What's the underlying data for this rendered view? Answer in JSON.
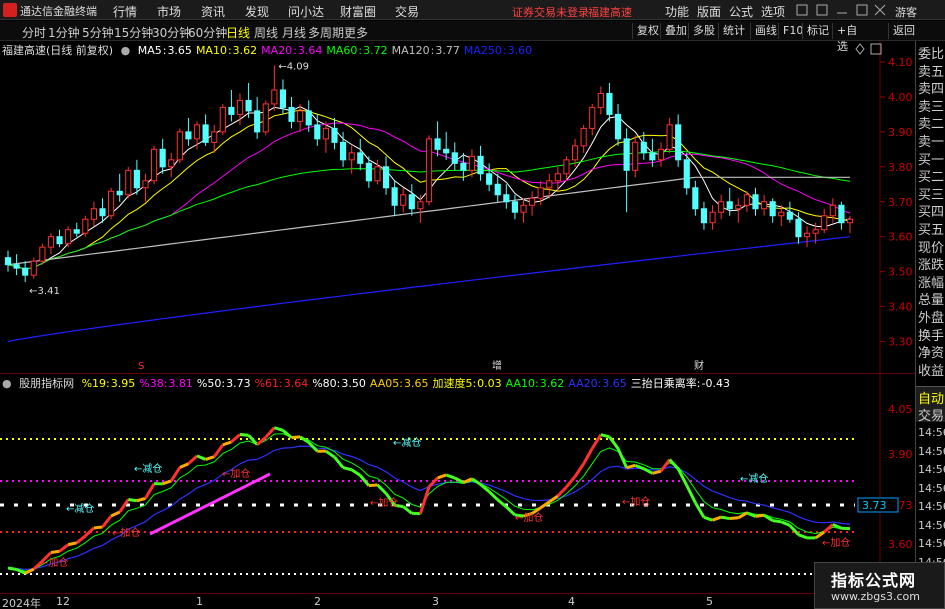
{
  "app": {
    "title": "通达信金融终端",
    "menu": [
      "行情",
      "市场",
      "资讯",
      "发现",
      "问小达",
      "财富圈",
      "交易"
    ],
    "account_status": "证券交易未登录",
    "account_stock": "福建高速",
    "right_menu": [
      "功能",
      "版面",
      "公式",
      "选项"
    ],
    "guest": "游客"
  },
  "periods": [
    "分时",
    "1分钟",
    "5分钟",
    "15分钟",
    "30分钟",
    "60分钟",
    "日线",
    "周线",
    "月线",
    "多周期",
    "更多"
  ],
  "active_period": "日线",
  "tools": [
    "复权",
    "叠加",
    "多股",
    "统计",
    "画线",
    "F10",
    "标记",
    "+自选",
    "返回"
  ],
  "main_chart": {
    "stock_label": "福建高速(日线 前复权)",
    "ma": [
      {
        "name": "MA5",
        "value": "3.65",
        "color": "#ffffff"
      },
      {
        "name": "MA10",
        "value": "3.62",
        "color": "#ffff00"
      },
      {
        "name": "MA20",
        "value": "3.64",
        "color": "#ff00ff"
      },
      {
        "name": "MA60",
        "value": "3.72",
        "color": "#00ff00"
      },
      {
        "name": "MA120",
        "value": "3.77",
        "color": "#c0c0c0"
      },
      {
        "name": "MA250",
        "value": "3.60",
        "color": "#2020ff"
      }
    ],
    "high_marker": "4.09",
    "low_marker": "3.41",
    "event_markers": [
      "S",
      "增",
      "财"
    ]
  },
  "indicator": {
    "name": "股朋指标网",
    "values": [
      {
        "label": "%19:",
        "value": "3.95",
        "color": "#ffff00"
      },
      {
        "label": "%38:",
        "value": "3.81",
        "color": "#ff00ff"
      },
      {
        "label": "%50:",
        "value": "3.73",
        "color": "#ffffff"
      },
      {
        "label": "%61:",
        "value": "3.64",
        "color": "#ff2020"
      },
      {
        "label": "%80:",
        "value": "3.50",
        "color": "#ffffff"
      },
      {
        "label": "AA05:",
        "value": "3.65",
        "color": "#ffcc00"
      },
      {
        "label": "加速度5:",
        "value": "0.03",
        "color": "#ffff00"
      },
      {
        "label": "AA10:",
        "value": "3.62",
        "color": "#00ff00"
      },
      {
        "label": "AA20:",
        "value": "3.65",
        "color": "#3030ff"
      },
      {
        "label": "三抬日乘离率:",
        "value": "-0.43",
        "color": "#ffffff"
      }
    ],
    "labels_reduce": "←减仓",
    "labels_add": "←加仓",
    "current_tag": "3.73"
  },
  "chart_data": {
    "type": "candlestick",
    "title": "福建高速(日线 前复权)",
    "y_axis_main": [
      "4.10",
      "4.00",
      "3.90",
      "3.80",
      "3.70",
      "3.60",
      "3.50",
      "3.40",
      "3.30"
    ],
    "ylim_main": [
      3.25,
      4.12
    ],
    "y_axis_ind": [
      "4.05",
      "3.90",
      "3.73",
      "3.60"
    ],
    "x_labels": [
      "2024年",
      "12",
      "1",
      "2",
      "3",
      "4",
      "5"
    ],
    "ohlc": [
      [
        3.54,
        3.56,
        3.5,
        3.52
      ],
      [
        3.52,
        3.55,
        3.49,
        3.51
      ],
      [
        3.51,
        3.53,
        3.47,
        3.49
      ],
      [
        3.49,
        3.54,
        3.48,
        3.53
      ],
      [
        3.53,
        3.58,
        3.52,
        3.57
      ],
      [
        3.57,
        3.61,
        3.55,
        3.6
      ],
      [
        3.6,
        3.62,
        3.57,
        3.58
      ],
      [
        3.58,
        3.63,
        3.57,
        3.62
      ],
      [
        3.62,
        3.64,
        3.6,
        3.61
      ],
      [
        3.61,
        3.66,
        3.6,
        3.65
      ],
      [
        3.65,
        3.7,
        3.63,
        3.68
      ],
      [
        3.68,
        3.71,
        3.64,
        3.66
      ],
      [
        3.66,
        3.74,
        3.65,
        3.73
      ],
      [
        3.73,
        3.78,
        3.7,
        3.72
      ],
      [
        3.72,
        3.8,
        3.71,
        3.79
      ],
      [
        3.79,
        3.82,
        3.72,
        3.74
      ],
      [
        3.74,
        3.78,
        3.7,
        3.76
      ],
      [
        3.76,
        3.86,
        3.75,
        3.85
      ],
      [
        3.85,
        3.88,
        3.78,
        3.8
      ],
      [
        3.8,
        3.84,
        3.77,
        3.82
      ],
      [
        3.82,
        3.91,
        3.81,
        3.9
      ],
      [
        3.9,
        3.94,
        3.86,
        3.88
      ],
      [
        3.88,
        3.93,
        3.85,
        3.92
      ],
      [
        3.92,
        3.95,
        3.86,
        3.87
      ],
      [
        3.87,
        3.92,
        3.84,
        3.9
      ],
      [
        3.9,
        3.98,
        3.89,
        3.97
      ],
      [
        3.97,
        4.02,
        3.93,
        3.95
      ],
      [
        3.95,
        4.01,
        3.92,
        3.99
      ],
      [
        3.99,
        4.04,
        3.94,
        3.96
      ],
      [
        3.96,
        4.0,
        3.88,
        3.9
      ],
      [
        3.9,
        3.99,
        3.89,
        3.98
      ],
      [
        3.98,
        4.09,
        3.96,
        4.02
      ],
      [
        4.02,
        4.05,
        3.95,
        3.97
      ],
      [
        3.97,
        4.0,
        3.91,
        3.93
      ],
      [
        3.93,
        3.98,
        3.9,
        3.96
      ],
      [
        3.96,
        3.99,
        3.9,
        3.92
      ],
      [
        3.92,
        3.95,
        3.86,
        3.88
      ],
      [
        3.88,
        3.93,
        3.84,
        3.91
      ],
      [
        3.91,
        3.94,
        3.85,
        3.87
      ],
      [
        3.87,
        3.9,
        3.8,
        3.82
      ],
      [
        3.82,
        3.86,
        3.78,
        3.84
      ],
      [
        3.84,
        3.88,
        3.79,
        3.81
      ],
      [
        3.81,
        3.83,
        3.74,
        3.76
      ],
      [
        3.76,
        3.82,
        3.75,
        3.8
      ],
      [
        3.8,
        3.83,
        3.72,
        3.74
      ],
      [
        3.74,
        3.76,
        3.66,
        3.69
      ],
      [
        3.69,
        3.74,
        3.67,
        3.72
      ],
      [
        3.72,
        3.75,
        3.66,
        3.68
      ],
      [
        3.68,
        3.72,
        3.64,
        3.7
      ],
      [
        3.7,
        3.89,
        3.69,
        3.88
      ],
      [
        3.88,
        3.93,
        3.83,
        3.85
      ],
      [
        3.85,
        3.9,
        3.82,
        3.84
      ],
      [
        3.84,
        3.87,
        3.79,
        3.81
      ],
      [
        3.81,
        3.84,
        3.76,
        3.79
      ],
      [
        3.79,
        3.85,
        3.77,
        3.83
      ],
      [
        3.83,
        3.86,
        3.76,
        3.78
      ],
      [
        3.78,
        3.81,
        3.73,
        3.75
      ],
      [
        3.75,
        3.78,
        3.7,
        3.72
      ],
      [
        3.72,
        3.75,
        3.68,
        3.7
      ],
      [
        3.7,
        3.72,
        3.65,
        3.67
      ],
      [
        3.67,
        3.71,
        3.64,
        3.69
      ],
      [
        3.69,
        3.73,
        3.66,
        3.71
      ],
      [
        3.71,
        3.76,
        3.69,
        3.74
      ],
      [
        3.74,
        3.78,
        3.71,
        3.76
      ],
      [
        3.76,
        3.8,
        3.73,
        3.78
      ],
      [
        3.78,
        3.83,
        3.76,
        3.82
      ],
      [
        3.82,
        3.88,
        3.8,
        3.86
      ],
      [
        3.86,
        3.92,
        3.84,
        3.91
      ],
      [
        3.91,
        3.98,
        3.89,
        3.97
      ],
      [
        3.97,
        4.03,
        3.95,
        4.01
      ],
      [
        4.01,
        4.04,
        3.93,
        3.95
      ],
      [
        3.95,
        3.98,
        3.86,
        3.88
      ],
      [
        3.88,
        3.91,
        3.67,
        3.79
      ],
      [
        3.79,
        3.89,
        3.77,
        3.87
      ],
      [
        3.87,
        3.9,
        3.82,
        3.84
      ],
      [
        3.84,
        3.88,
        3.8,
        3.82
      ],
      [
        3.82,
        3.87,
        3.8,
        3.85
      ],
      [
        3.85,
        3.94,
        3.84,
        3.92
      ],
      [
        3.92,
        3.95,
        3.8,
        3.82
      ],
      [
        3.82,
        3.84,
        3.72,
        3.74
      ],
      [
        3.74,
        3.76,
        3.66,
        3.68
      ],
      [
        3.68,
        3.7,
        3.62,
        3.64
      ],
      [
        3.64,
        3.69,
        3.62,
        3.67
      ],
      [
        3.67,
        3.72,
        3.65,
        3.7
      ],
      [
        3.7,
        3.74,
        3.66,
        3.68
      ],
      [
        3.68,
        3.71,
        3.64,
        3.69
      ],
      [
        3.69,
        3.73,
        3.67,
        3.72
      ],
      [
        3.72,
        3.74,
        3.66,
        3.68
      ],
      [
        3.68,
        3.72,
        3.66,
        3.7
      ],
      [
        3.7,
        3.71,
        3.64,
        3.66
      ],
      [
        3.66,
        3.69,
        3.63,
        3.67
      ],
      [
        3.67,
        3.7,
        3.64,
        3.65
      ],
      [
        3.65,
        3.67,
        3.58,
        3.6
      ],
      [
        3.6,
        3.63,
        3.57,
        3.61
      ],
      [
        3.61,
        3.64,
        3.58,
        3.62
      ],
      [
        3.62,
        3.68,
        3.61,
        3.66
      ],
      [
        3.66,
        3.71,
        3.64,
        3.69
      ],
      [
        3.69,
        3.7,
        3.62,
        3.64
      ],
      [
        3.64,
        3.66,
        3.61,
        3.65
      ]
    ]
  },
  "sidebar": {
    "quote_rows": [
      "委比",
      "卖五",
      "卖四",
      "卖三",
      "卖二",
      "卖一",
      "买一",
      "买二",
      "买三",
      "买四",
      "买五",
      "现价",
      "涨跌",
      "涨幅",
      "总量",
      "外盘",
      "换手",
      "净资",
      "收益"
    ],
    "tab_labels": [
      "自动",
      "交易"
    ],
    "times": [
      "14:56",
      "14:56",
      "14:56",
      "14:56",
      "14:56",
      "14:56",
      "14:56",
      "14:56",
      "14:56"
    ]
  },
  "watermark": {
    "title": "指标公式网",
    "url": "www.zbgs3.com"
  }
}
